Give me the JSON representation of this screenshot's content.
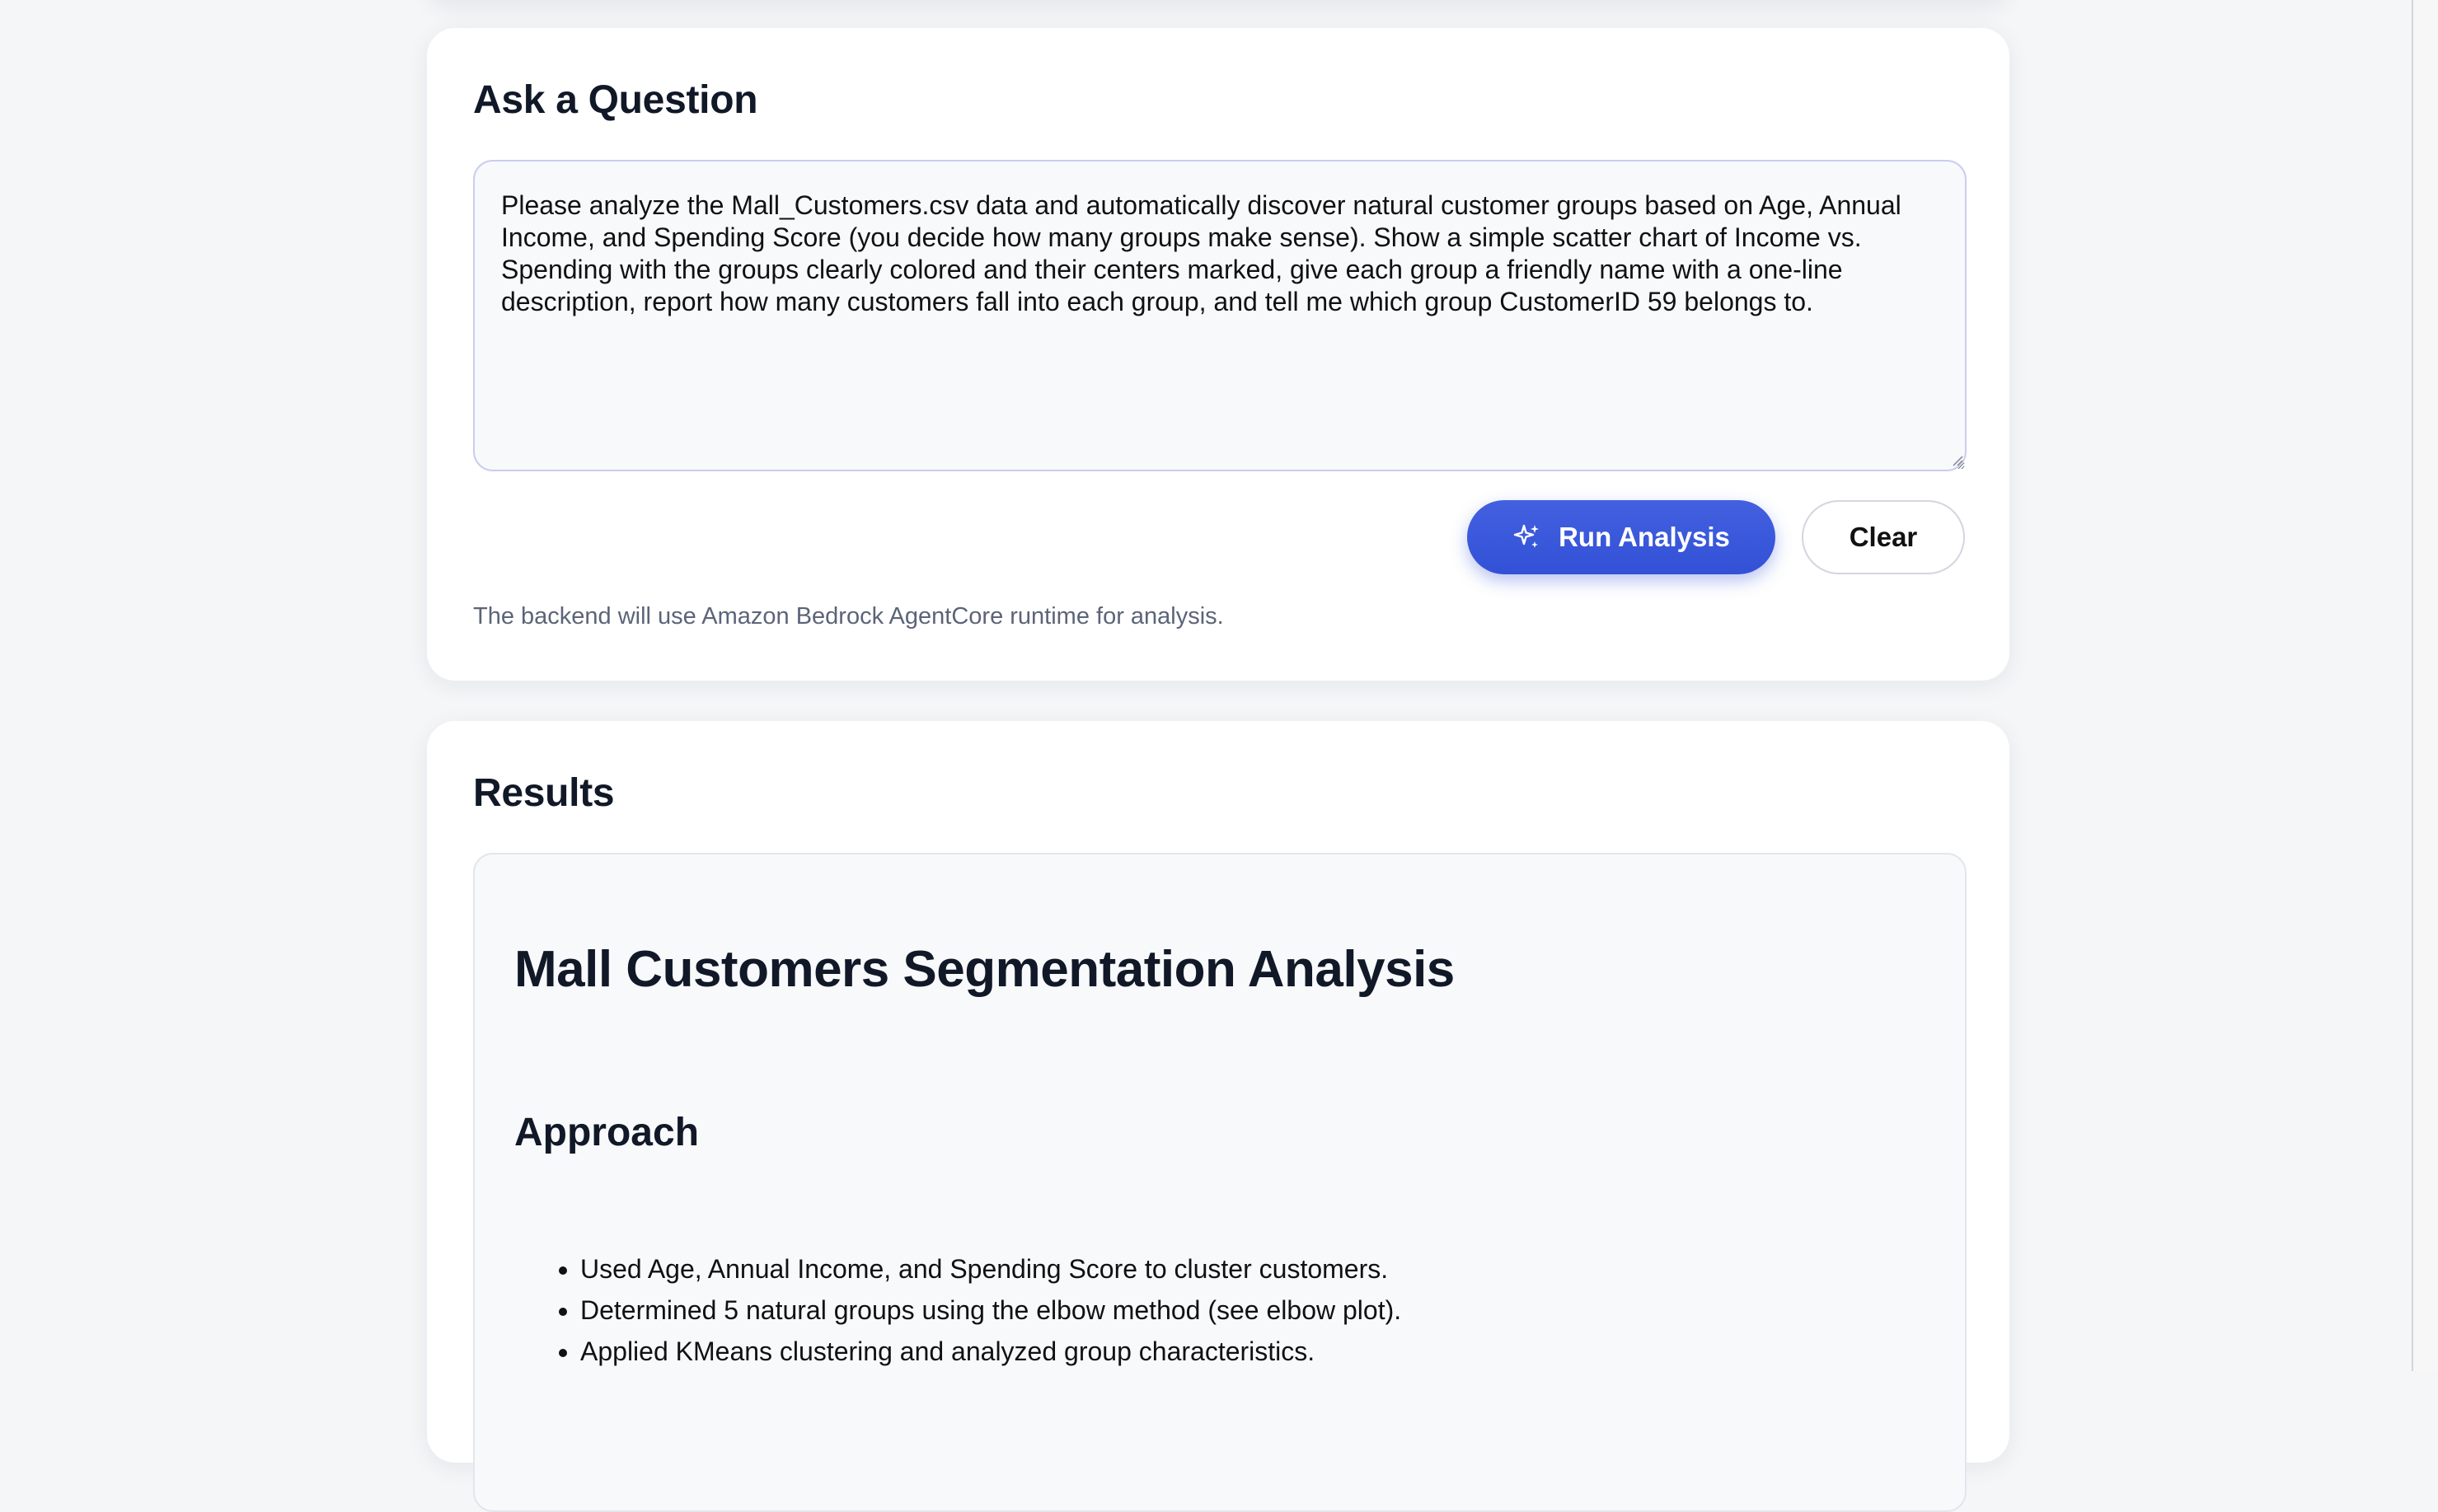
{
  "ask": {
    "title": "Ask a Question",
    "question_text": "Please analyze the Mall_Customers.csv data and automatically discover natural customer groups based on Age, Annual Income, and Spending Score (you decide how many groups make sense). Show a simple scatter chart of Income vs. Spending with the groups clearly colored and their centers marked, give each group a friendly name with a one-line description, report how many customers fall into each group, and tell me which group CustomerID 59 belongs to.",
    "run_button_label": "Run Analysis",
    "run_button_icon": "sparkle-icon",
    "clear_button_label": "Clear",
    "backend_note": "The backend will use Amazon Bedrock AgentCore runtime for analysis."
  },
  "results": {
    "title": "Results",
    "report_title": "Mall Customers Segmentation Analysis",
    "approach_heading": "Approach",
    "approach_items": [
      "Used Age, Annual Income, and Spending Score to cluster customers.",
      "Determined 5 natural groups using the elbow method (see elbow plot).",
      "Applied KMeans clustering and analyzed group characteristics."
    ]
  },
  "colors": {
    "accent": "#3351d6",
    "page_background": "#f5f6f8",
    "card_background": "#ffffff",
    "muted_text": "#5b6478"
  }
}
